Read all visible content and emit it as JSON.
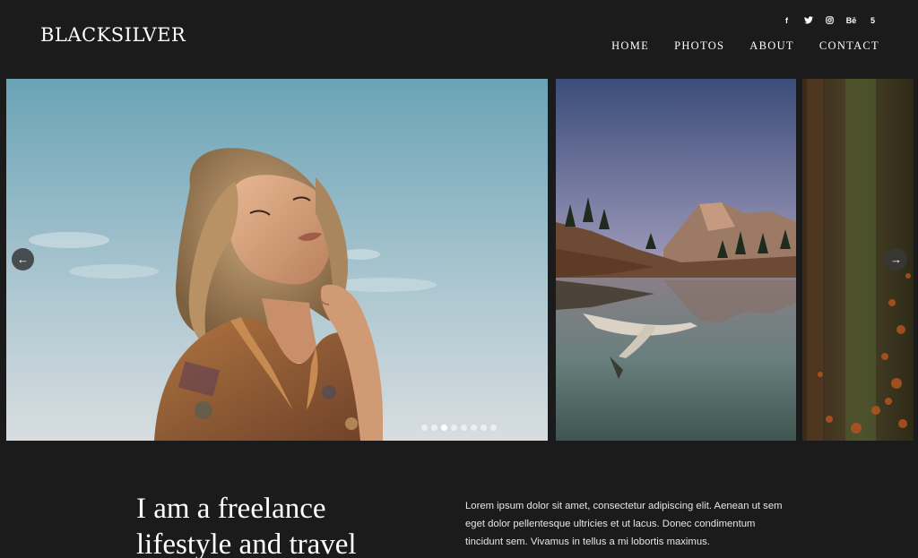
{
  "header": {
    "logo": "BLACKSILVER",
    "socials": [
      {
        "icon": "facebook-icon",
        "glyph": "f"
      },
      {
        "icon": "twitter-icon",
        "glyph": "🐦"
      },
      {
        "icon": "instagram-icon",
        "glyph": "◎"
      },
      {
        "icon": "behance-icon",
        "glyph": "Bē"
      },
      {
        "icon": "500px-icon",
        "glyph": "5"
      }
    ],
    "nav": [
      "HOME",
      "PHOTOS",
      "ABOUT",
      "CONTACT"
    ]
  },
  "slider": {
    "prev_icon": "arrow-left-icon",
    "next_icon": "arrow-right-icon",
    "dots_total": 8,
    "active_dot": 3
  },
  "intro": {
    "heading": "I am a freelance lifestyle and travel",
    "text": "Lorem ipsum dolor sit amet, consectetur adipiscing elit. Aenean ut sem eget dolor pellentesque ultricies et ut lacus. Donec condimentum tincidunt sem. Vivamus in tellus a mi lobortis maximus."
  }
}
